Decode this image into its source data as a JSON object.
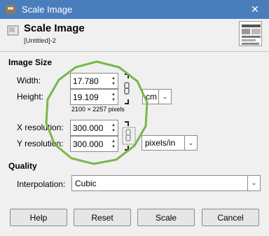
{
  "window": {
    "title": "Scale Image",
    "close_symbol": "✕"
  },
  "header": {
    "title": "Scale Image",
    "subtitle": "[Untitled]-2"
  },
  "image_size": {
    "section_label": "Image Size",
    "width_label": "Width:",
    "width_value": "17.780",
    "height_label": "Height:",
    "height_value": "19.109",
    "size_unit": "cm",
    "pixel_dimensions": "2100 × 2257 pixels",
    "xres_label": "X resolution:",
    "xres_value": "300.000",
    "yres_label": "Y resolution:",
    "yres_value": "300.000",
    "res_unit": "pixels/in"
  },
  "quality": {
    "section_label": "Quality",
    "interpolation_label": "Interpolation:",
    "interpolation_value": "Cubic"
  },
  "buttons": {
    "help": "Help",
    "reset": "Reset",
    "scale": "Scale",
    "cancel": "Cancel"
  },
  "icons": {
    "app": "gimp-app-icon",
    "scale": "scale-image-icon",
    "chain_size": "chain-linked-icon",
    "chain_res": "chain-linked-icon",
    "close": "close-icon",
    "dropdown": "chevron-down-icon"
  },
  "colors": {
    "titlebar": "#4a7dbb",
    "annotation_circle": "#7ab648"
  }
}
